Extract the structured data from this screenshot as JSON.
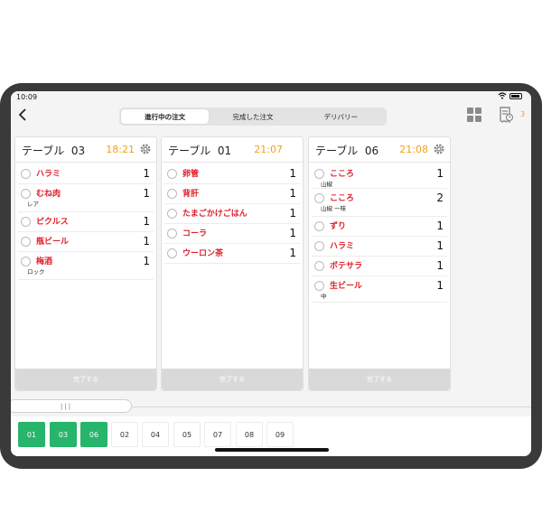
{
  "statusbar": {
    "time": "10:09"
  },
  "segments": {
    "items": [
      {
        "label": "進行中の注文"
      },
      {
        "label": "完成した注文"
      },
      {
        "label": "デリバリー"
      }
    ],
    "active": 0
  },
  "header_right": {
    "receipt_count": "3"
  },
  "colors": {
    "accent_time": "#f0a020",
    "item_red": "#e0202a",
    "tab_active": "#27b46b"
  },
  "cards": [
    {
      "table_label": "テーブル",
      "table_no": "03",
      "time": "18:21",
      "items": [
        {
          "name": "ハラミ",
          "qty": "1",
          "note": ""
        },
        {
          "name": "むね肉",
          "qty": "1",
          "note": "レア"
        },
        {
          "name": "ピクルス",
          "qty": "1",
          "note": ""
        },
        {
          "name": "瓶ビール",
          "qty": "1",
          "note": ""
        },
        {
          "name": "梅酒",
          "qty": "1",
          "note": "ロック"
        }
      ],
      "done_label": "完了する"
    },
    {
      "table_label": "テーブル",
      "table_no": "01",
      "time": "21:07",
      "items": [
        {
          "name": "卵管",
          "qty": "1",
          "note": ""
        },
        {
          "name": "背肝",
          "qty": "1",
          "note": ""
        },
        {
          "name": "たまごかけごはん",
          "qty": "1",
          "note": ""
        },
        {
          "name": "コーラ",
          "qty": "1",
          "note": ""
        },
        {
          "name": "ウーロン茶",
          "qty": "1",
          "note": ""
        }
      ],
      "done_label": "完了する"
    },
    {
      "table_label": "テーブル",
      "table_no": "06",
      "time": "21:08",
      "items": [
        {
          "name": "こころ",
          "qty": "1",
          "note": "山椒"
        },
        {
          "name": "こころ",
          "qty": "2",
          "note": "山椒 一味"
        },
        {
          "name": "ずり",
          "qty": "1",
          "note": ""
        },
        {
          "name": "ハラミ",
          "qty": "1",
          "note": ""
        },
        {
          "name": "ポテサラ",
          "qty": "1",
          "note": ""
        },
        {
          "name": "生ビール",
          "qty": "1",
          "note": "中"
        }
      ],
      "done_label": "完了する"
    }
  ],
  "scroll_handle": {
    "grip": "|||"
  },
  "table_tabs": [
    {
      "label": "01",
      "active": true
    },
    {
      "label": "03",
      "active": true
    },
    {
      "label": "06",
      "active": true
    },
    {
      "label": "02",
      "active": false
    },
    {
      "label": "04",
      "active": false
    },
    {
      "label": "05",
      "active": false
    },
    {
      "label": "07",
      "active": false
    },
    {
      "label": "08",
      "active": false
    },
    {
      "label": "09",
      "active": false
    }
  ]
}
